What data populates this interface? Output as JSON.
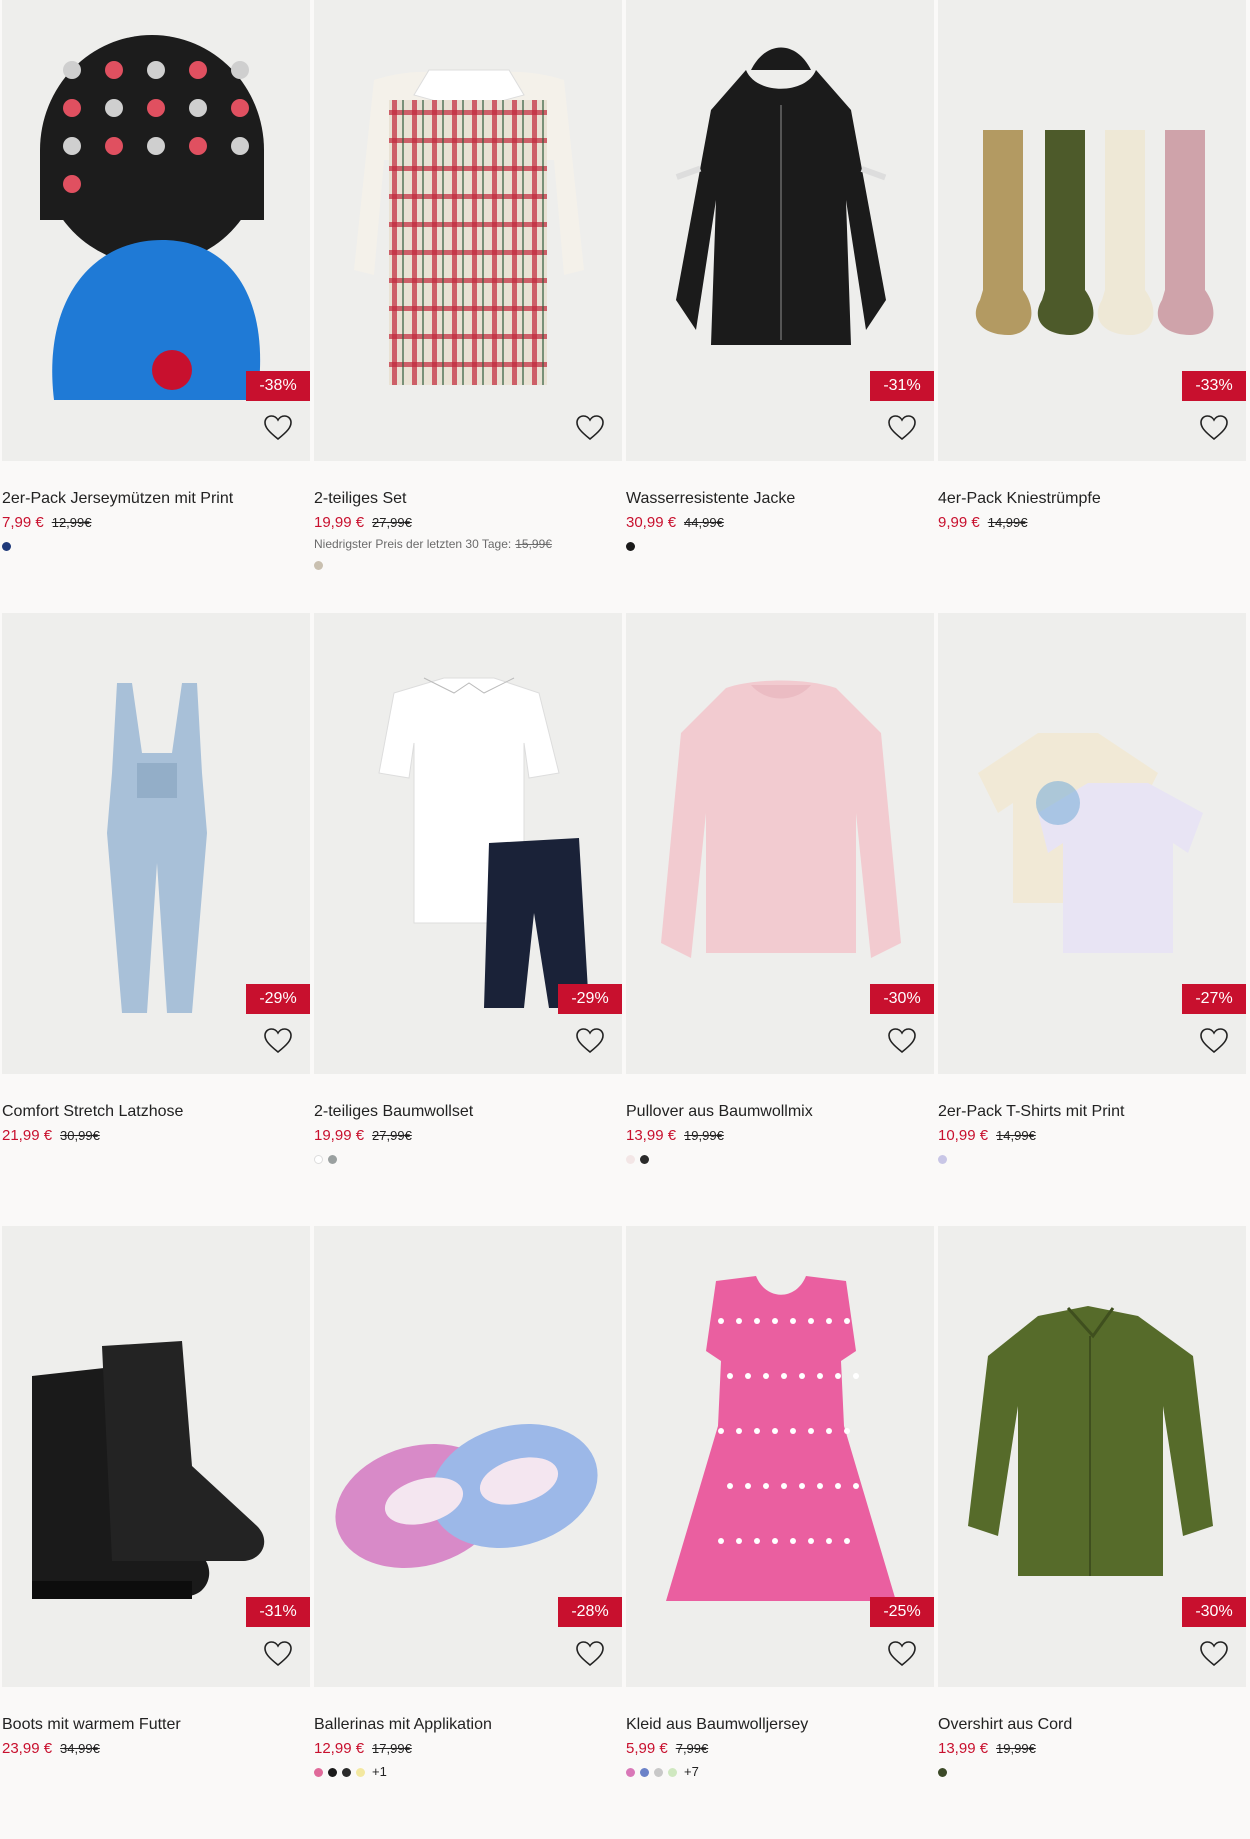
{
  "accent_color": "#c8102e",
  "products": [
    {
      "title": "2er-Pack Jerseymützen mit Print",
      "price": "7,99 €",
      "old_price": "12,99€",
      "discount": "-38%",
      "swatches": [
        "#1f3a7a"
      ],
      "more": "",
      "image": "beanies-icon"
    },
    {
      "title": "2-teiliges Set",
      "price": "19,99 €",
      "old_price": "27,99€",
      "discount": "",
      "lowest_label": "Niedrigster Preis der letzten 30 Tage:",
      "lowest_price": "15,99€",
      "swatches": [
        "#c9c0b0"
      ],
      "more": "",
      "image": "plaid-dress-icon"
    },
    {
      "title": "Wasserresistente Jacke",
      "price": "30,99 €",
      "old_price": "44,99€",
      "discount": "-31%",
      "swatches": [
        "#1a1a1a"
      ],
      "more": "",
      "image": "jacket-icon"
    },
    {
      "title": "4er-Pack Kniestrümpfe",
      "price": "9,99 €",
      "old_price": "14,99€",
      "discount": "-33%",
      "swatches": [],
      "more": "",
      "image": "socks-icon"
    },
    {
      "title": "Comfort Stretch Latzhose",
      "price": "21,99 €",
      "old_price": "30,99€",
      "discount": "-29%",
      "swatches": [],
      "more": "",
      "image": "overalls-icon"
    },
    {
      "title": "2-teiliges Baumwollset",
      "price": "19,99 €",
      "old_price": "27,99€",
      "discount": "-29%",
      "swatches": [
        "#ffffff",
        "#9aa0a0"
      ],
      "more": "",
      "image": "shirt-shorts-icon"
    },
    {
      "title": "Pullover aus Baumwollmix",
      "price": "13,99 €",
      "old_price": "19,99€",
      "discount": "-30%",
      "swatches": [
        "#f3e6e6",
        "#2a2a2a"
      ],
      "more": "",
      "image": "sweater-icon"
    },
    {
      "title": "2er-Pack T-Shirts mit Print",
      "price": "10,99 €",
      "old_price": "14,99€",
      "discount": "-27%",
      "swatches": [
        "#c8c6e6"
      ],
      "more": "",
      "image": "tshirts-icon"
    },
    {
      "title": "Boots mit warmem Futter",
      "price": "23,99 €",
      "old_price": "34,99€",
      "discount": "-31%",
      "swatches": [],
      "more": "",
      "image": "boots-icon"
    },
    {
      "title": "Ballerinas mit Applikation",
      "price": "12,99 €",
      "old_price": "17,99€",
      "discount": "-28%",
      "swatches": [
        "#e06a9a",
        "#1a1a1a",
        "#2a2a2a",
        "#f3e8a0"
      ],
      "more": "+1",
      "image": "ballerinas-icon"
    },
    {
      "title": "Kleid aus Baumwolljersey",
      "price": "5,99 €",
      "old_price": "7,99€",
      "discount": "-25%",
      "swatches": [
        "#d978b8",
        "#6b82c8",
        "#c8c8c8",
        "#cfe8c0"
      ],
      "more": "+7",
      "image": "dress-icon"
    },
    {
      "title": "Overshirt aus Cord",
      "price": "13,99 €",
      "old_price": "19,99€",
      "discount": "-30%",
      "swatches": [
        "#3c4a28"
      ],
      "more": "",
      "image": "overshirt-icon"
    }
  ]
}
